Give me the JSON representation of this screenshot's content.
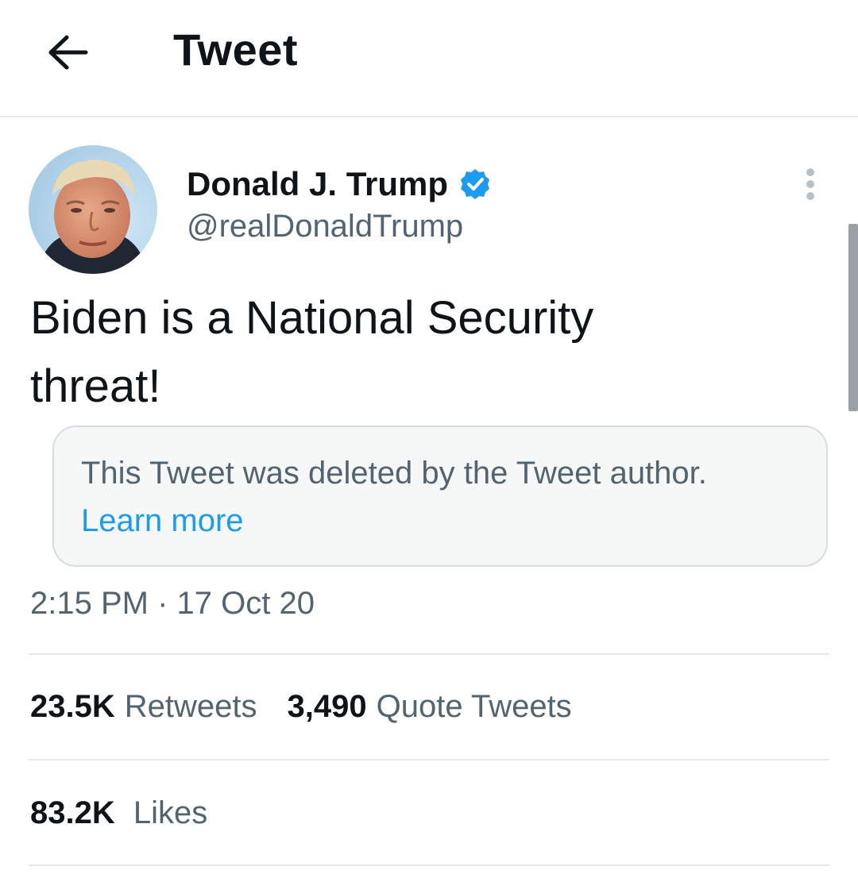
{
  "header": {
    "back_icon": "arrow-left-icon",
    "title": "Tweet"
  },
  "tweet": {
    "author": {
      "name": "Donald J. Trump",
      "handle": "@realDonaldTrump",
      "verified": true,
      "verified_icon": "verified-badge-icon",
      "verified_color": "#1d9bf0"
    },
    "more_icon": "more-vertical-icon",
    "text_line1": "Biden is a National Security",
    "text_line2": "threat!",
    "deleted_notice": {
      "text": "This Tweet was deleted by the Tweet author.",
      "link": "Learn more"
    },
    "timestamp": "2:15 PM · 17 Oct 20",
    "stats": {
      "retweets_count": "23.5K",
      "retweets_label": "Retweets",
      "quote_count": "3,490",
      "quote_label": "Quote Tweets",
      "likes_count": "83.2K",
      "likes_label": "Likes"
    }
  },
  "colors": {
    "text_primary": "#0f1419",
    "text_secondary": "#536471",
    "link": "#1d9bf0",
    "divider": "#e3e8ec"
  }
}
